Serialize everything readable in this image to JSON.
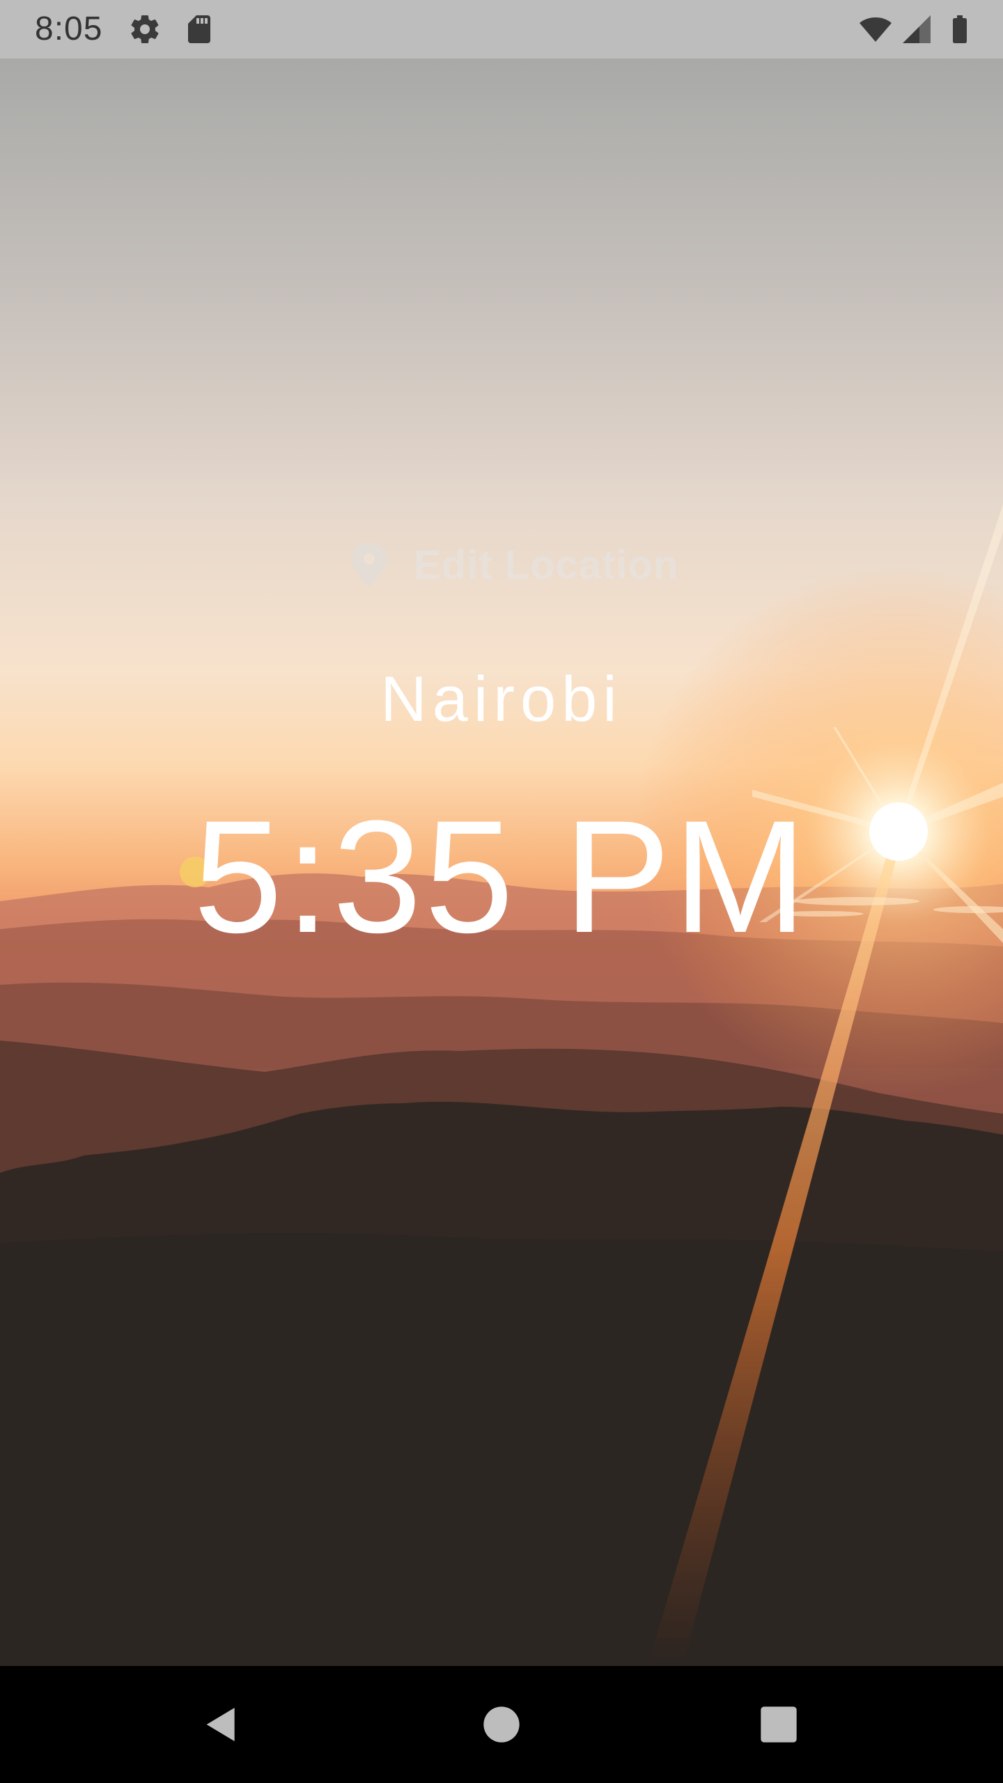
{
  "status_bar": {
    "time": "8:05",
    "icons": [
      "gear-icon",
      "sd-card-icon",
      "wifi-icon",
      "signal-icon",
      "battery-icon"
    ]
  },
  "location_button": {
    "label": "Edit Location",
    "icon": "location-pin-icon"
  },
  "location": {
    "city": "Nairobi",
    "time": "5:35 PM"
  },
  "nav_bar": {
    "buttons": [
      "back-icon",
      "home-icon",
      "recents-icon"
    ]
  },
  "colors": {
    "status_bar_bg": "#bdbdbd",
    "status_icon": "#3a3a3a",
    "text": "#ffffff",
    "nav_bar_bg": "#000000",
    "nav_icon": "#bdbdbd"
  }
}
